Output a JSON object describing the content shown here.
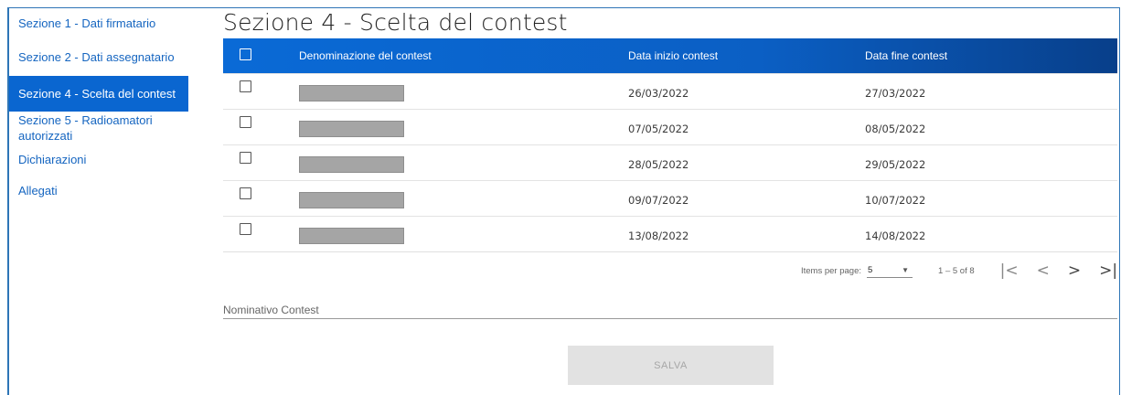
{
  "sidebar": {
    "items": [
      {
        "label": "Sezione 1 - Dati firmatario"
      },
      {
        "label": "Sezione 2 - Dati assegnatario"
      },
      {
        "label": "Sezione 4 - Scelta del contest",
        "active": true
      },
      {
        "label": "Sezione 5 - Radioamatori autorizzati"
      },
      {
        "label": "Dichiarazioni"
      },
      {
        "label": "Allegati"
      }
    ]
  },
  "page": {
    "title": "Sezione 4 - Scelta del contest"
  },
  "table": {
    "headers": {
      "name": "Denominazione del contest",
      "start": "Data inizio contest",
      "end": "Data fine contest"
    },
    "rows": [
      {
        "start": "26/03/2022",
        "end": "27/03/2022"
      },
      {
        "start": "07/05/2022",
        "end": "08/05/2022"
      },
      {
        "start": "28/05/2022",
        "end": "29/05/2022"
      },
      {
        "start": "09/07/2022",
        "end": "10/07/2022"
      },
      {
        "start": "13/08/2022",
        "end": "14/08/2022"
      }
    ]
  },
  "paginator": {
    "items_per_page_label": "Items per page:",
    "items_per_page_value": "5",
    "range": "1 – 5 of 8"
  },
  "form": {
    "nominativo_placeholder": "Nominativo Contest"
  },
  "actions": {
    "save_label": "SALVA"
  },
  "colors": {
    "accent": "#0a66d0",
    "header_gradient_end": "#083f8a",
    "link": "#1565c0"
  }
}
